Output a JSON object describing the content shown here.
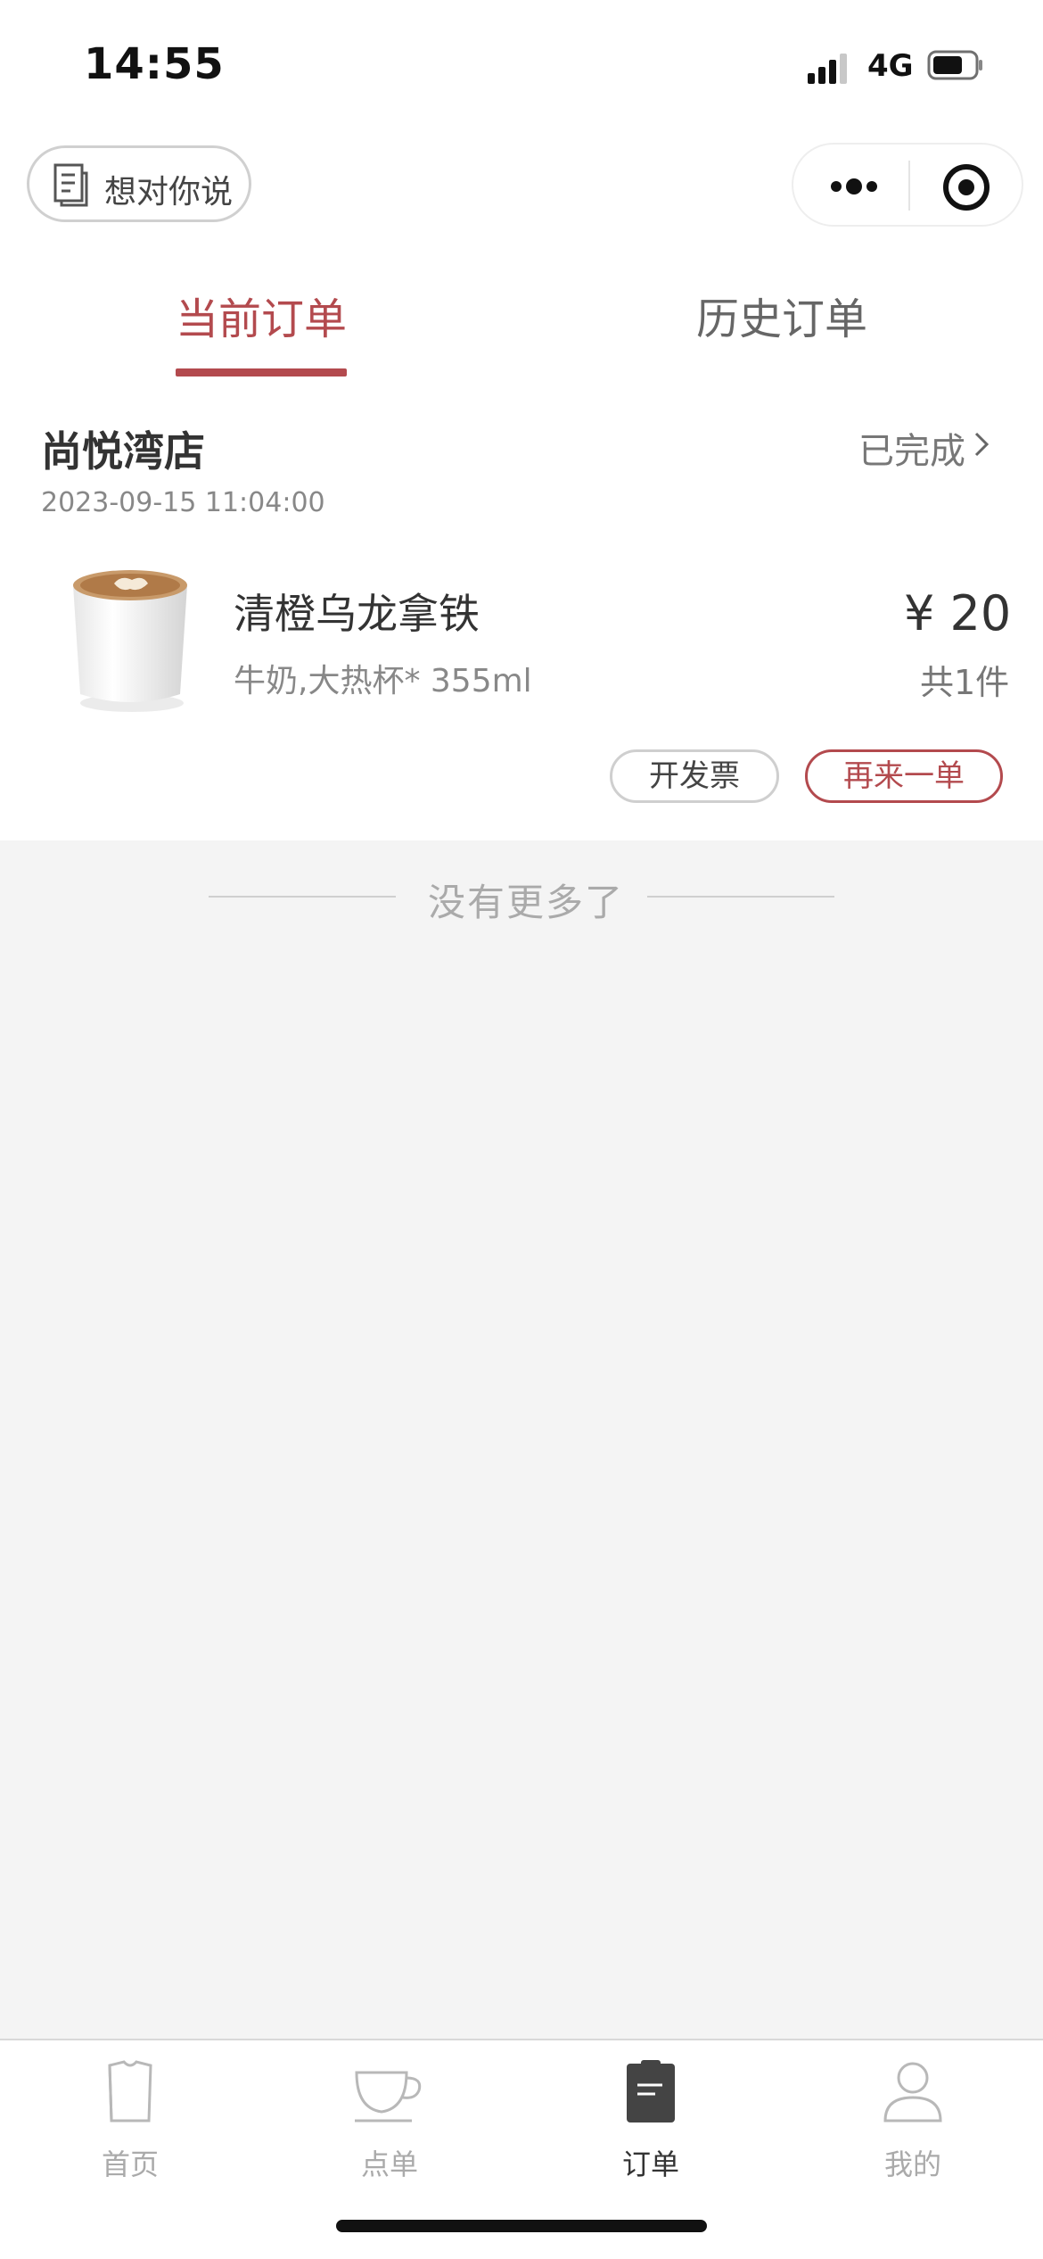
{
  "status_bar": {
    "time": "14:55",
    "network": "4G",
    "signal_icon": "signal-bars-icon",
    "battery_icon": "battery-icon"
  },
  "header": {
    "feedback_label": "想对你说",
    "feedback_icon": "document-icon",
    "more_icon": "more-dots-icon",
    "close_icon": "target-circle-icon"
  },
  "tabs": [
    {
      "label": "当前订单",
      "active": true
    },
    {
      "label": "历史订单",
      "active": false
    }
  ],
  "order": {
    "store": "尚悦湾店",
    "status": "已完成",
    "time": "2023-09-15 11:04:00",
    "item": {
      "name": "清橙乌龙拿铁",
      "spec": "牛奶,大热杯* 355ml",
      "price": "¥ 20",
      "count": "共1件",
      "image": "latte-cup-image"
    },
    "actions": {
      "invoice": "开发票",
      "reorder": "再来一单"
    }
  },
  "list_end_text": "没有更多了",
  "tabbar": [
    {
      "label": "首页",
      "icon": "tshirt-home-icon",
      "active": false
    },
    {
      "label": "点单",
      "icon": "coffee-cup-icon",
      "active": false
    },
    {
      "label": "订单",
      "icon": "order-list-icon",
      "active": true
    },
    {
      "label": "我的",
      "icon": "user-icon",
      "active": false
    }
  ],
  "colors": {
    "accent": "#b34a4e",
    "background": "#f4f4f4"
  }
}
